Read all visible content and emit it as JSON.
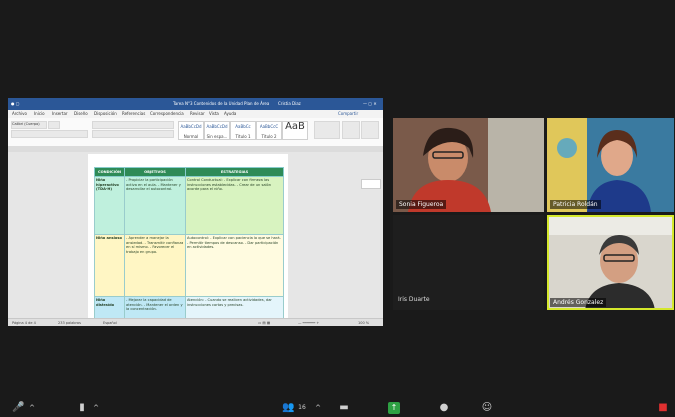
{
  "word": {
    "title": "Tarea N°3 Contenidos de la Unidad Plan de Área",
    "account": "Cristia Diaz",
    "menu": [
      "Archivo",
      "Inicio",
      "Insertar",
      "Diseño",
      "Disposición",
      "Referencias",
      "Correspondencia",
      "Revisar",
      "Vista",
      "Ayuda"
    ],
    "share_label": "Compartir",
    "font": "Calibri (Cuerpo)",
    "styles": [
      {
        "label": "AaBbCcDd",
        "sub": "Normal"
      },
      {
        "label": "AaBbCcDd",
        "sub": "Sin espa..."
      },
      {
        "label": "AaBbCc",
        "sub": "Título 1"
      },
      {
        "label": "AaBbCcC",
        "sub": "Título 2"
      },
      {
        "label": "AaB",
        "sub": "Título"
      }
    ],
    "table": {
      "headers": [
        "CONDICIÓN",
        "OBJETIVOS",
        "ESTRATEGIAS"
      ],
      "rows": [
        {
          "cond": "Niño hiperactivo (TDA-H)",
          "obj": "- Propiciar la participación activa en el aula. - Mantener y desarrollar el autocontrol.",
          "est": "Control Conductual: - Explicar con firmeza las instrucciones establecidas. - Crear de un salón acorde para el niño."
        },
        {
          "cond": "Niño ansioso",
          "obj": "- Aprender a manejar la ansiedad. - Transmitir confianza en sí mismo. - Favorecer el trabajo en grupo.",
          "est": "Autocontrol: - Explicar con paciencia lo que se hará. - Permitir tiempos de descanso. - Dar participación en actividades."
        },
        {
          "cond": "Niño distraído",
          "obj": "- Mejorar la capacidad de atención. - Mantener el orden y la concentración.",
          "est": "Atención: - Cuando se realicen actividades, dar instrucciones cortas y precisas."
        }
      ]
    },
    "status": {
      "page": "Página 4 de 4",
      "words": "233 palabras",
      "lang": "Español",
      "zoom": "100 %"
    }
  },
  "participants": [
    {
      "name": "Sonia Figueroa",
      "active": false
    },
    {
      "name": "Patricia Roldán",
      "active": false
    },
    {
      "name": "Iris Duarte",
      "active": false
    },
    {
      "name": "Andrés Gonzalez",
      "active": true
    }
  ],
  "toolbar": {
    "participants_count": "16"
  },
  "colors": {
    "accent_highlight": "#d5e82c",
    "word_blue": "#2b5797",
    "record_red": "#e03030",
    "share_green": "#2ea043"
  }
}
